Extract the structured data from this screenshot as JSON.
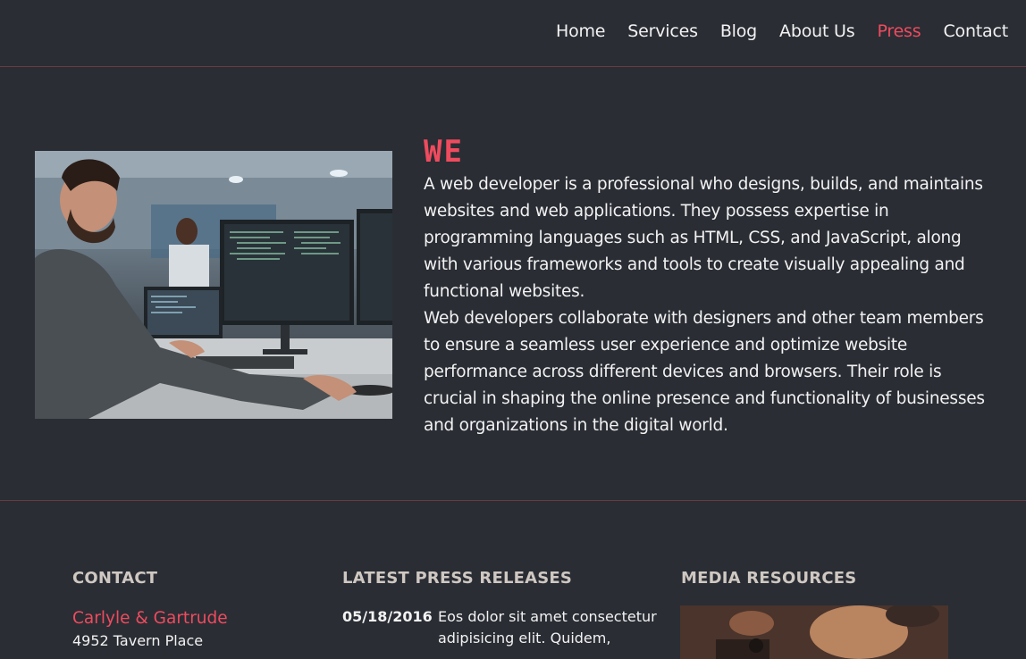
{
  "nav": {
    "items": [
      {
        "label": "Home"
      },
      {
        "label": "Services"
      },
      {
        "label": "Blog"
      },
      {
        "label": "About Us"
      },
      {
        "label": "Press"
      },
      {
        "label": "Contact"
      }
    ],
    "active": "Press"
  },
  "about": {
    "title": "WE",
    "paragraph1": "A web developer is a professional who designs, builds, and maintains websites and web applications. They possess expertise in programming languages such as HTML, CSS, and JavaScript, along with various frameworks and tools to create visually appealing and functional websites.",
    "paragraph2": "Web developers collaborate with designers and other team members to ensure a seamless user experience and optimize website performance across different devices and browsers. Their role is crucial in shaping the online presence and functionality of businesses and organizations in the digital world."
  },
  "footer": {
    "contact": {
      "heading": "CONTACT",
      "name": "Carlyle & Gartrude",
      "address": "4952 Tavern Place"
    },
    "press": {
      "heading": "LATEST PRESS RELEASES",
      "date": "05/18/2016",
      "text": "Eos dolor sit amet consectetur adipisicing elit. Quidem,"
    },
    "media": {
      "heading": "MEDIA RESOURCES"
    }
  },
  "colors": {
    "background": "#2a2d34",
    "accent": "#ef4b5e",
    "divider": "#6a3a42"
  }
}
